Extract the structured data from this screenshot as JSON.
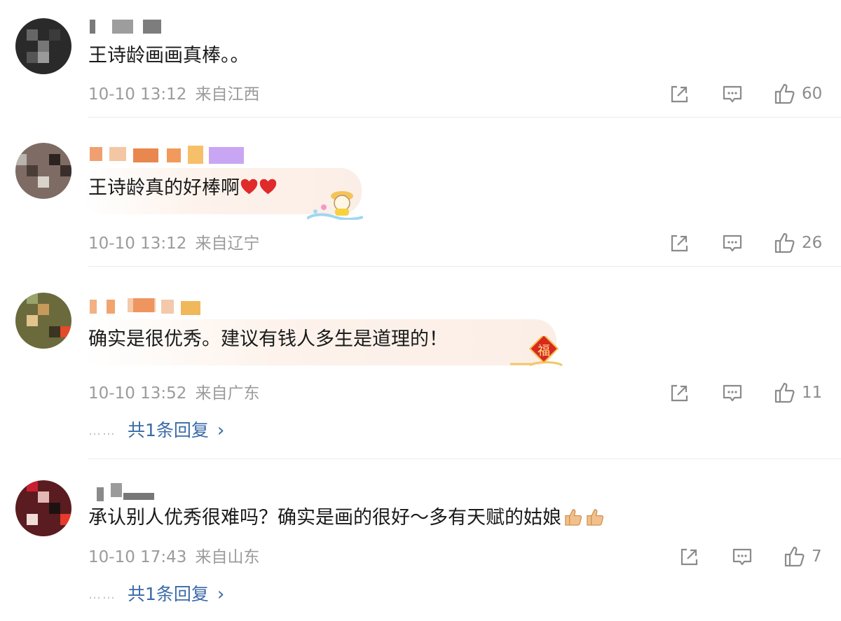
{
  "comments": [
    {
      "text": "王诗龄画画真棒。。",
      "time": "10-10 13:12",
      "location": "来自江西",
      "likes": "60"
    },
    {
      "text": "王诗龄真的好棒啊",
      "time": "10-10 13:12",
      "location": "来自辽宁",
      "likes": "26"
    },
    {
      "text": "确实是很优秀。建议有钱人多生是道理的！",
      "time": "10-10 13:52",
      "location": "来自广东",
      "likes": "11",
      "reply": {
        "dots": "……",
        "label": "共1条回复",
        "chevron": "›"
      }
    },
    {
      "text": "承认别人优秀很难吗？确实是画的很好～多有天赋的姑娘",
      "time": "10-10 17:43",
      "location": "来自山东",
      "likes": "7",
      "reply": {
        "dots": "……",
        "label": "共1条回复",
        "chevron": "›"
      }
    }
  ],
  "stickers": {
    "fu": "福"
  },
  "icons": {
    "share": "share-icon",
    "comment": "comment-icon",
    "like": "like-icon"
  },
  "colors": {
    "meta": "#9b9b9b",
    "reply_link": "#3a6aa8",
    "separator": "#ececec"
  }
}
